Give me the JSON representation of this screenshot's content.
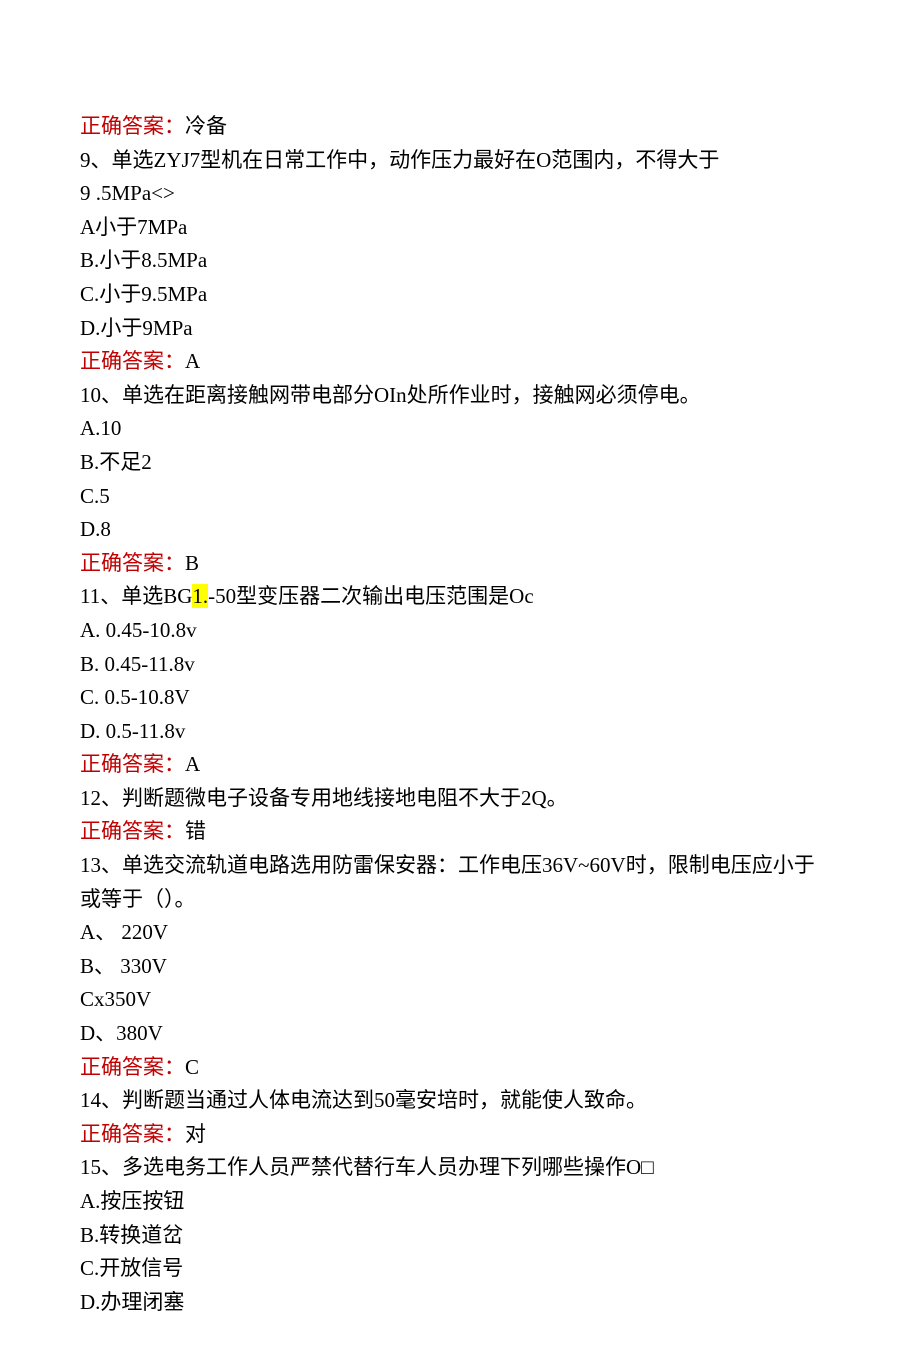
{
  "answer_label": "正确答案：",
  "q8_answer": "冷备",
  "q9_line1": "9、单选ZYJ7型机在日常工作中，动作压力最好在O范围内，不得大于",
  "q9_line2": "9 .5MPa<>",
  "q9_optA": "A小于7MPa",
  "q9_optB": "B.小于8.5MPa",
  "q9_optC": "C.小于9.5MPa",
  "q9_optD": "D.小于9MPa",
  "q9_answer": "A",
  "q10_line1": "10、单选在距离接触网带电部分OIn处所作业时，接触网必须停电。",
  "q10_optA": "A.10",
  "q10_optB": "B.不足2",
  "q10_optC": "C.5",
  "q10_optD": "D.8",
  "q10_answer": "B",
  "q11_pre": "11、单选BG",
  "q11_hl": "1.",
  "q11_post": "-50型变压器二次输出电压范围是Oc",
  "q11_optA": "A. 0.45-10.8v",
  "q11_optB": "B. 0.45-11.8v",
  "q11_optC": "C. 0.5-10.8V",
  "q11_optD": "D. 0.5-11.8v",
  "q11_answer": "A",
  "q12_line1": "12、判断题微电子设备专用地线接地电阻不大于2Q。",
  "q12_answer": "错",
  "q13_line1": "13、单选交流轨道电路选用防雷保安器：工作电压36V~60V时，限制电压应小于",
  "q13_line2": "或等于（）。",
  "q13_optA": "A、 220V",
  "q13_optB": "B、 330V",
  "q13_optC": "Cx350V",
  "q13_optD": "D、380V",
  "q13_answer": "C",
  "q14_line1": "14、判断题当通过人体电流达到50毫安培时，就能使人致命。",
  "q14_answer": "对",
  "q15_line1": "15、多选电务工作人员严禁代替行车人员办理下列哪些操作O□",
  "q15_optA": "A.按压按钮",
  "q15_optB": "B.转换道岔",
  "q15_optC": "C.开放信号",
  "q15_optD": "D.办理闭塞"
}
